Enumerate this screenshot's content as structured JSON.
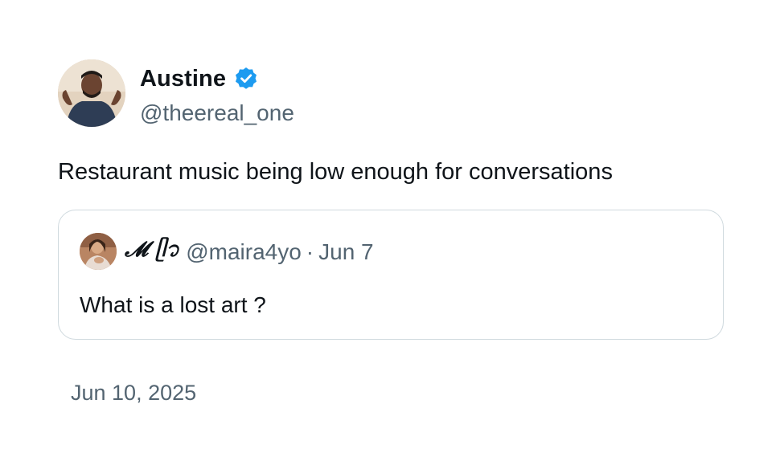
{
  "author": {
    "display_name": "Austine",
    "handle": "@theereal_one",
    "verified_icon": "verified-badge-icon",
    "verified_color": "#1d9bf0"
  },
  "tweet": {
    "text": "Restaurant music being low enough for conversations",
    "timestamp": "Jun 10, 2025"
  },
  "quoted_tweet": {
    "display_name": "𝓜 ᥫ᭡",
    "handle": "@maira4yo",
    "separator": "·",
    "date": "Jun 7",
    "text": "What is a lost art ?"
  },
  "colors": {
    "text_primary": "#0f1419",
    "text_secondary": "#536471",
    "border": "#cfd9de"
  }
}
